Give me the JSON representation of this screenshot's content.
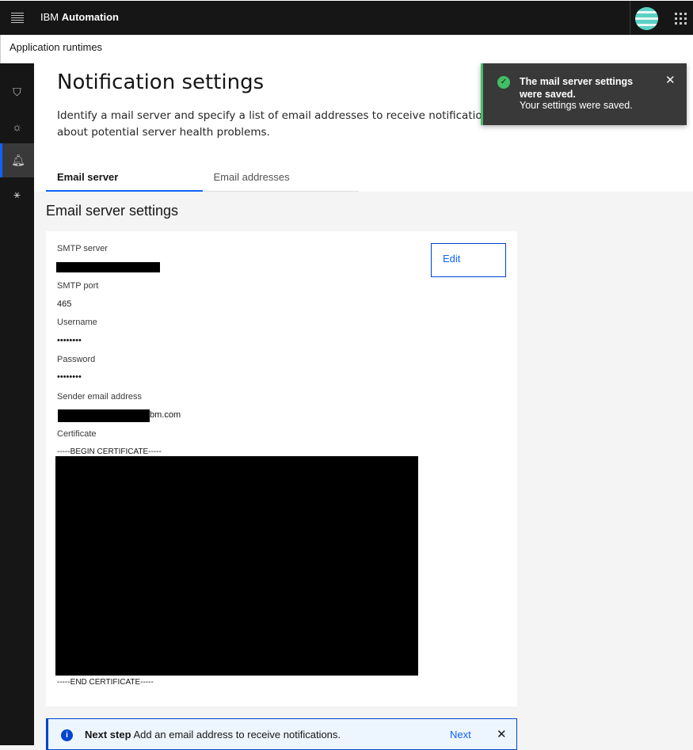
{
  "header": {
    "brand_prefix": "IBM",
    "brand_name": "Automation"
  },
  "breadcrumb": "Application runtimes",
  "rail": [
    {
      "icon": "shield-icon"
    },
    {
      "icon": "sun-icon"
    },
    {
      "icon": "bell-icon",
      "active": true
    },
    {
      "icon": "network-icon"
    }
  ],
  "page": {
    "title": "Notification settings",
    "description": "Identify a mail server and specify a list of email addresses to receive notifications about potential server health problems."
  },
  "tabs": [
    {
      "label": "Email server",
      "active": true
    },
    {
      "label": "Email addresses"
    }
  ],
  "section_title": "Email server settings",
  "fields": {
    "smtp_server_label": "SMTP server",
    "smtp_port_label": "SMTP port",
    "smtp_port": "465",
    "username_label": "Username",
    "username": "••••••••",
    "password_label": "Password",
    "password": "••••••••",
    "sender_label": "Sender email address",
    "sender_suffix": "bm.com",
    "certificate_label": "Certificate",
    "cert_begin": "-----BEGIN CERTIFICATE-----",
    "cert_end": "-----END CERTIFICATE-----"
  },
  "edit_label": "Edit",
  "toast": {
    "title": "The mail server settings were saved.",
    "subtitle": "Your settings were saved.",
    "color": "#42be65"
  },
  "next_step": {
    "title": "Next step",
    "message": "Add an email address to receive notifications.",
    "action": "Next"
  }
}
